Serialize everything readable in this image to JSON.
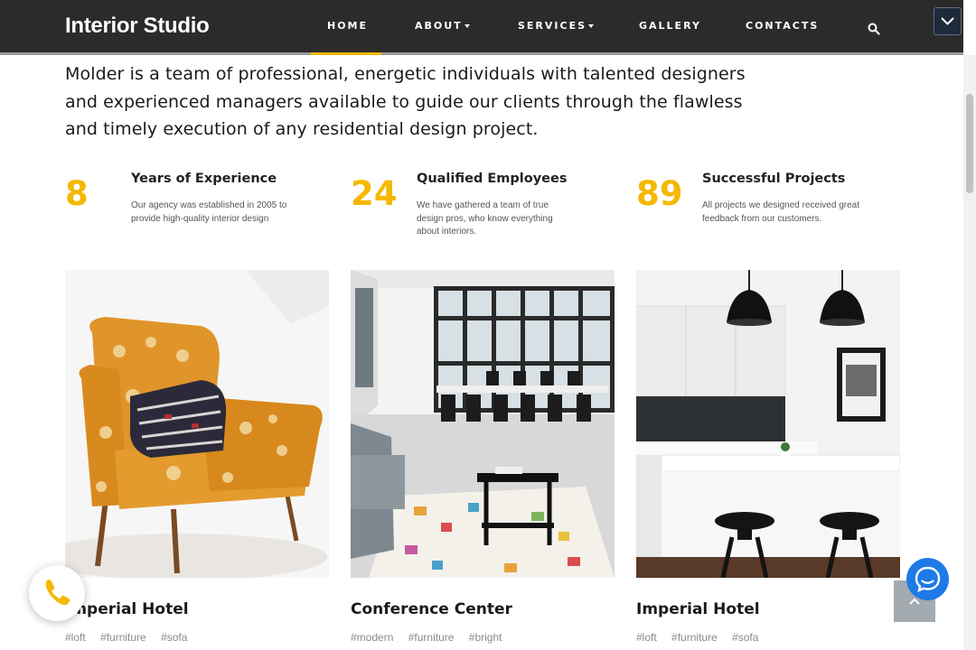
{
  "header": {
    "brand": "Interior Studio",
    "nav": [
      {
        "label": "HOME",
        "active": true
      },
      {
        "label": "ABOUT",
        "dropdown": true
      },
      {
        "label": "SERVICES",
        "dropdown": true
      },
      {
        "label": "GALLERY"
      },
      {
        "label": "CONTACTS"
      }
    ],
    "search_icon": "search-icon",
    "scroll_button_icon": "chevron-down-icon"
  },
  "intro": {
    "text": "Molder is a team of professional, energetic individuals with talented designers and experienced managers available to guide our clients through the flawless and timely execution of any residential design project."
  },
  "stats": [
    {
      "number": "8",
      "title": "Years of Experience",
      "desc": "Our agency was established in 2005 to provide high-quality interior design"
    },
    {
      "number": "24",
      "title": "Qualified Employees",
      "desc": "We have gathered a team of true design pros, who know everything about interiors."
    },
    {
      "number": "89",
      "title": "Successful Projects",
      "desc": "All projects we designed received great feedback from our customers."
    }
  ],
  "projects": [
    {
      "title": "Imperial Hotel",
      "tags": [
        "#loft",
        "#furniture",
        "#sofa"
      ],
      "image": "armchair-photo"
    },
    {
      "title": "Conference Center",
      "tags": [
        "#modern",
        "#furniture",
        "#bright"
      ],
      "image": "conference-room-photo"
    },
    {
      "title": "Imperial Hotel",
      "tags": [
        "#loft",
        "#furniture",
        "#sofa"
      ],
      "image": "kitchen-photo"
    }
  ],
  "floating": {
    "phone_icon": "phone-icon",
    "chat_icon": "chat-icon",
    "to_top_icon": "chevron-up-icon"
  },
  "colors": {
    "accent": "#f5b800",
    "header_bg": "#2b2b2b",
    "chat_blue": "#1e7ae6"
  }
}
